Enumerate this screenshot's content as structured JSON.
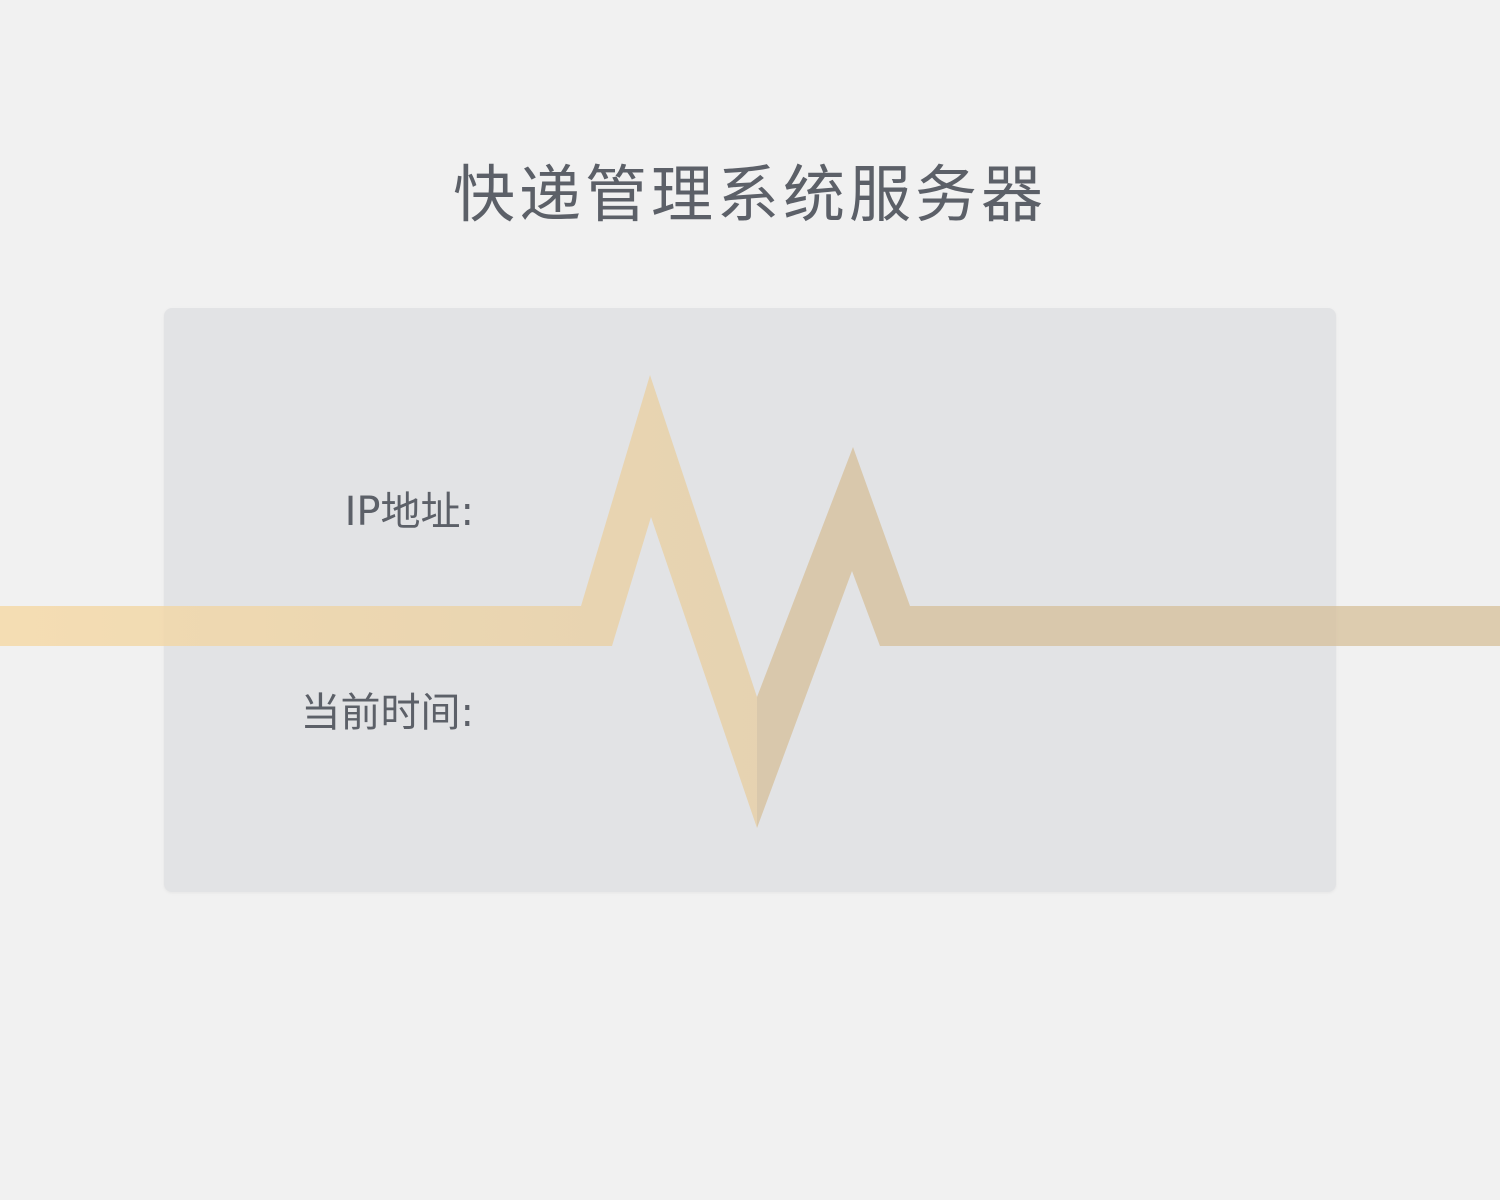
{
  "header": {
    "title": "快递管理系统服务器"
  },
  "info_card": {
    "ip_label": "IP地址:",
    "ip_value": "",
    "time_label": "当前时间:",
    "time_value": ""
  },
  "colors": {
    "background": "#f1f1f1",
    "card": "#e2e3e5",
    "text": "#5c6068",
    "pulse_left": "#f5d9a6",
    "pulse_right": "#d9c4a1"
  },
  "decoration": {
    "heartbeat_line": "heartbeat-pulse-icon"
  }
}
